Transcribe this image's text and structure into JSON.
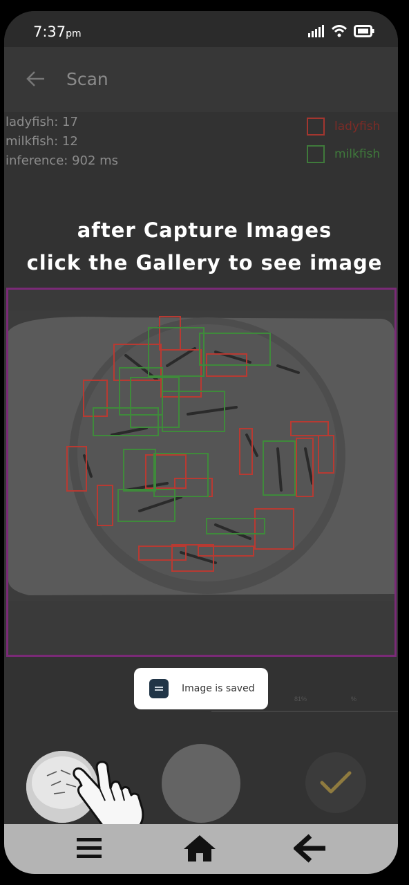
{
  "status_bar": {
    "time": "7:37",
    "time_suffix": "pm"
  },
  "app_bar": {
    "title": "Scan"
  },
  "stats": {
    "ladyfish": "ladyfish: 17",
    "milkfish": "milkfish: 12",
    "inference": "inference: 902 ms"
  },
  "legend": [
    {
      "label": "ladyfish",
      "color": "#b83a32"
    },
    {
      "label": "milkfish",
      "color": "#3f8a3b"
    }
  ],
  "caption": {
    "line1": "after Capture Images",
    "line2": "click the Gallery to see image"
  },
  "toast": {
    "text": "Image is saved"
  },
  "faint_labels": {
    "left": "81%",
    "right": "%"
  },
  "colors": {
    "ladyfish_box": "#b83a32",
    "milkfish_box": "#3f8a3b",
    "frame": "#7a2a77",
    "confirm_check": "#b8953a"
  },
  "icons": [
    "back-arrow-icon",
    "signal-icon",
    "wifi-icon",
    "battery-icon",
    "toast-app-icon",
    "checkmark-icon",
    "pointing-hand-icon",
    "menu-icon",
    "home-icon",
    "back-nav-icon"
  ]
}
